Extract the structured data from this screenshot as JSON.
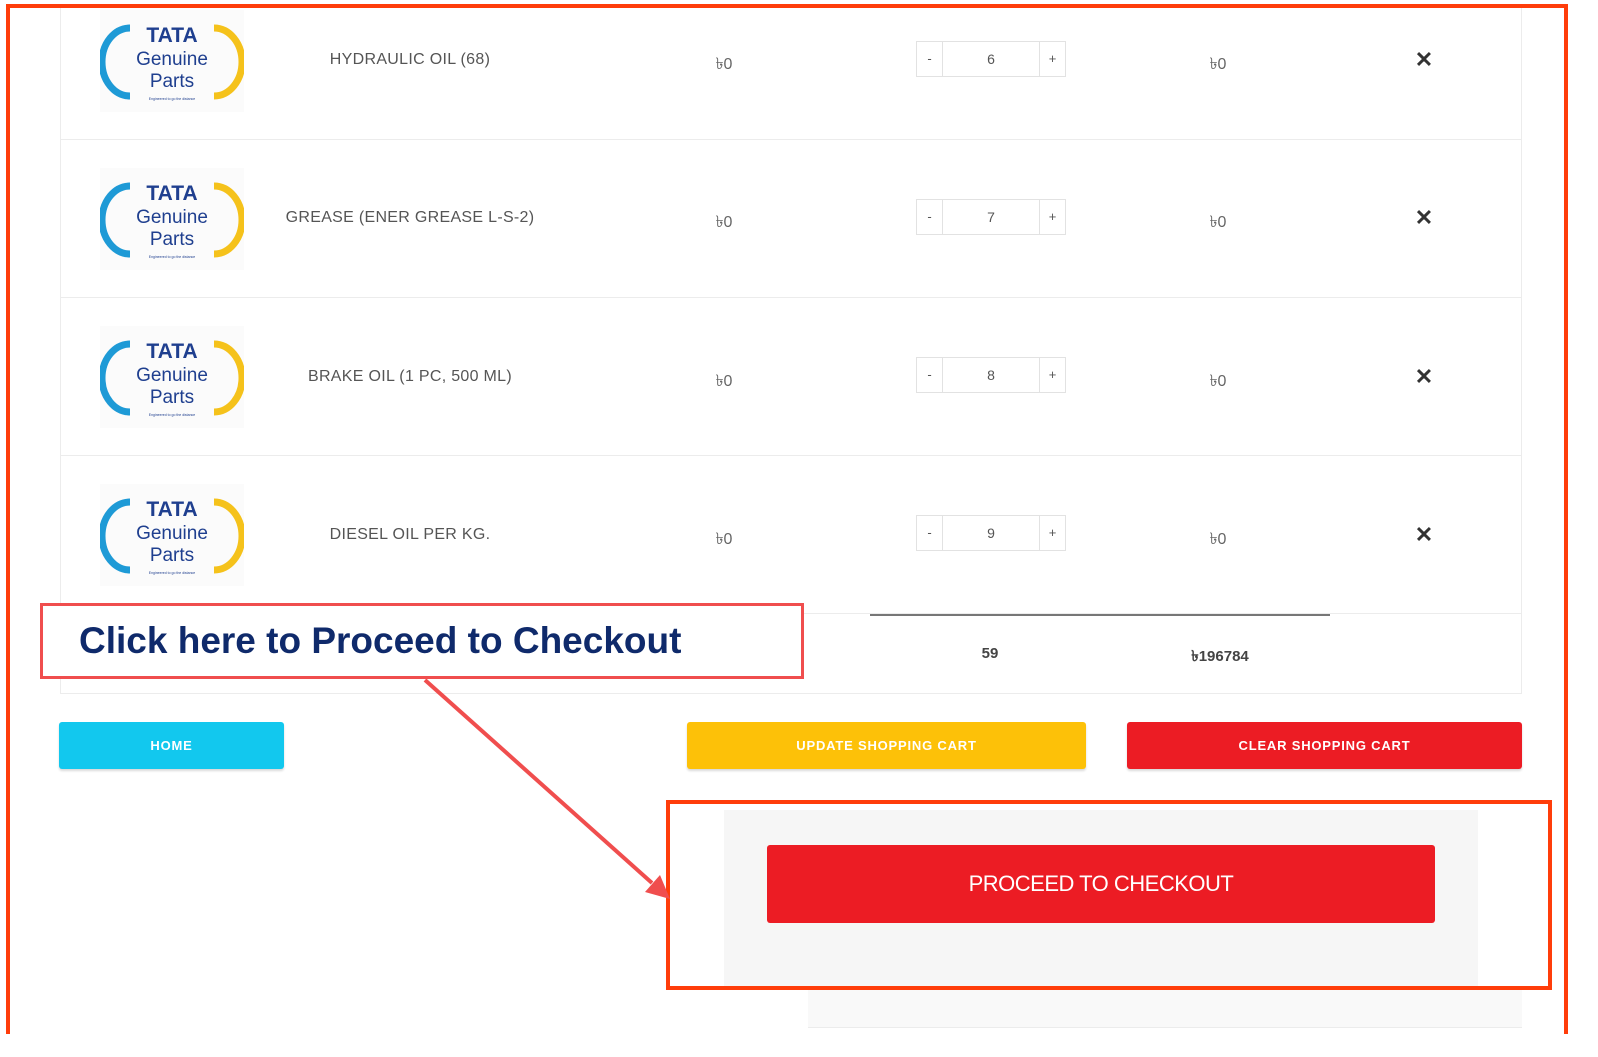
{
  "currency_symbol": "৳",
  "cart": {
    "items": [
      {
        "name": "HYDRAULIC OIL (68)",
        "price": "৳0",
        "quantity": "6",
        "subtotal": "৳0"
      },
      {
        "name": "GREASE (ENER GREASE L-S-2)",
        "price": "৳0",
        "quantity": "7",
        "subtotal": "৳0"
      },
      {
        "name": "BRAKE OIL (1 PC, 500 ML)",
        "price": "৳0",
        "quantity": "8",
        "subtotal": "৳0"
      },
      {
        "name": "DIESEL OIL PER KG.",
        "price": "৳0",
        "quantity": "9",
        "subtotal": "৳0"
      }
    ],
    "qty_minus": "-",
    "qty_plus": "+",
    "remove_glyph": "✕",
    "totals": {
      "quantity": "59",
      "amount": "৳196784"
    }
  },
  "logo": {
    "line1": "TATA",
    "line2": "Genuine",
    "line3": "Parts",
    "tagline": "Engineered to go the distance"
  },
  "buttons": {
    "home": "HOME",
    "update": "UPDATE SHOPPING CART",
    "clear": "CLEAR SHOPPING CART",
    "checkout": "PROCEED TO CHECKOUT"
  },
  "annotation": {
    "callout_text": "Click here to Proceed to Checkout"
  },
  "colors": {
    "home": "#12c8ee",
    "update": "#fdc108",
    "clear": "#ec1c24",
    "checkout": "#ec1c24",
    "highlight": "#ff3d0a",
    "callout_text": "#0f2a6b"
  }
}
